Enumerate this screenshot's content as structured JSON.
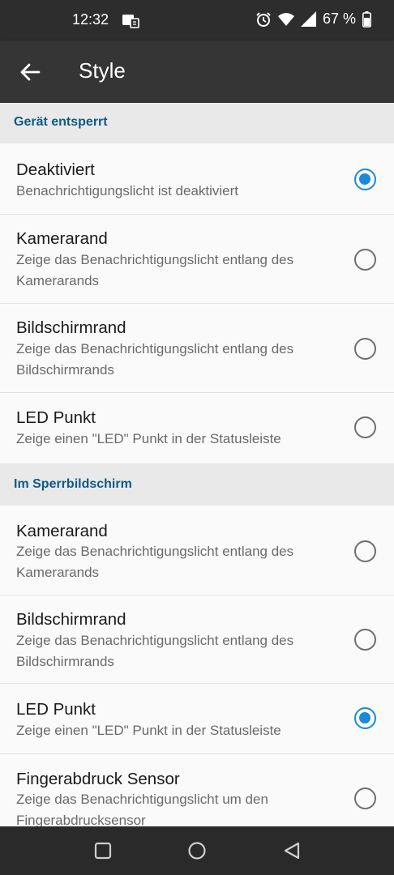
{
  "statusbar": {
    "time": "12:32",
    "battery": "67 %"
  },
  "appbar": {
    "title": "Style"
  },
  "sections": [
    {
      "label": "Gerät entsperrt"
    },
    {
      "label": "Im Sperrbildschirm"
    }
  ],
  "items": [
    {
      "title": "Deaktiviert",
      "line1": "Benachrichtigungslicht ist deaktiviert",
      "line2": "",
      "selected": true
    },
    {
      "title": "Kamerarand",
      "line1": "Zeige das Benachrichtigungslicht entlang des",
      "line2": "Kamerarands",
      "selected": false
    },
    {
      "title": "Bildschirmrand",
      "line1": "Zeige das Benachrichtigungslicht entlang des",
      "line2": "Bildschirmrands",
      "selected": false
    },
    {
      "title": "LED Punkt",
      "line1": "Zeige einen \"LED\" Punkt in der Statusleiste",
      "line2": "",
      "selected": false
    },
    {
      "title": "Kamerarand",
      "line1": "Zeige das Benachrichtigungslicht entlang des",
      "line2": "Kamerarands",
      "selected": false
    },
    {
      "title": "Bildschirmrand",
      "line1": "Zeige das Benachrichtigungslicht entlang des",
      "line2": "Bildschirmrands",
      "selected": false
    },
    {
      "title": "LED Punkt",
      "line1": "Zeige einen \"LED\" Punkt in der Statusleiste",
      "line2": "",
      "selected": true
    },
    {
      "title": "Fingerabdruck Sensor",
      "line1": "Zeige das Benachrichtigungslicht um den",
      "line2": "Fingerabdrucksensor",
      "selected": false
    }
  ],
  "colors": {
    "accent": "#1b8ad6",
    "section_text": "#0f5a86"
  },
  "icons": [
    "back-arrow-icon",
    "alarm-icon",
    "wifi-icon",
    "signal-icon",
    "battery-icon",
    "sim-card-icon",
    "recents-icon",
    "home-icon",
    "back-triangle-icon"
  ]
}
